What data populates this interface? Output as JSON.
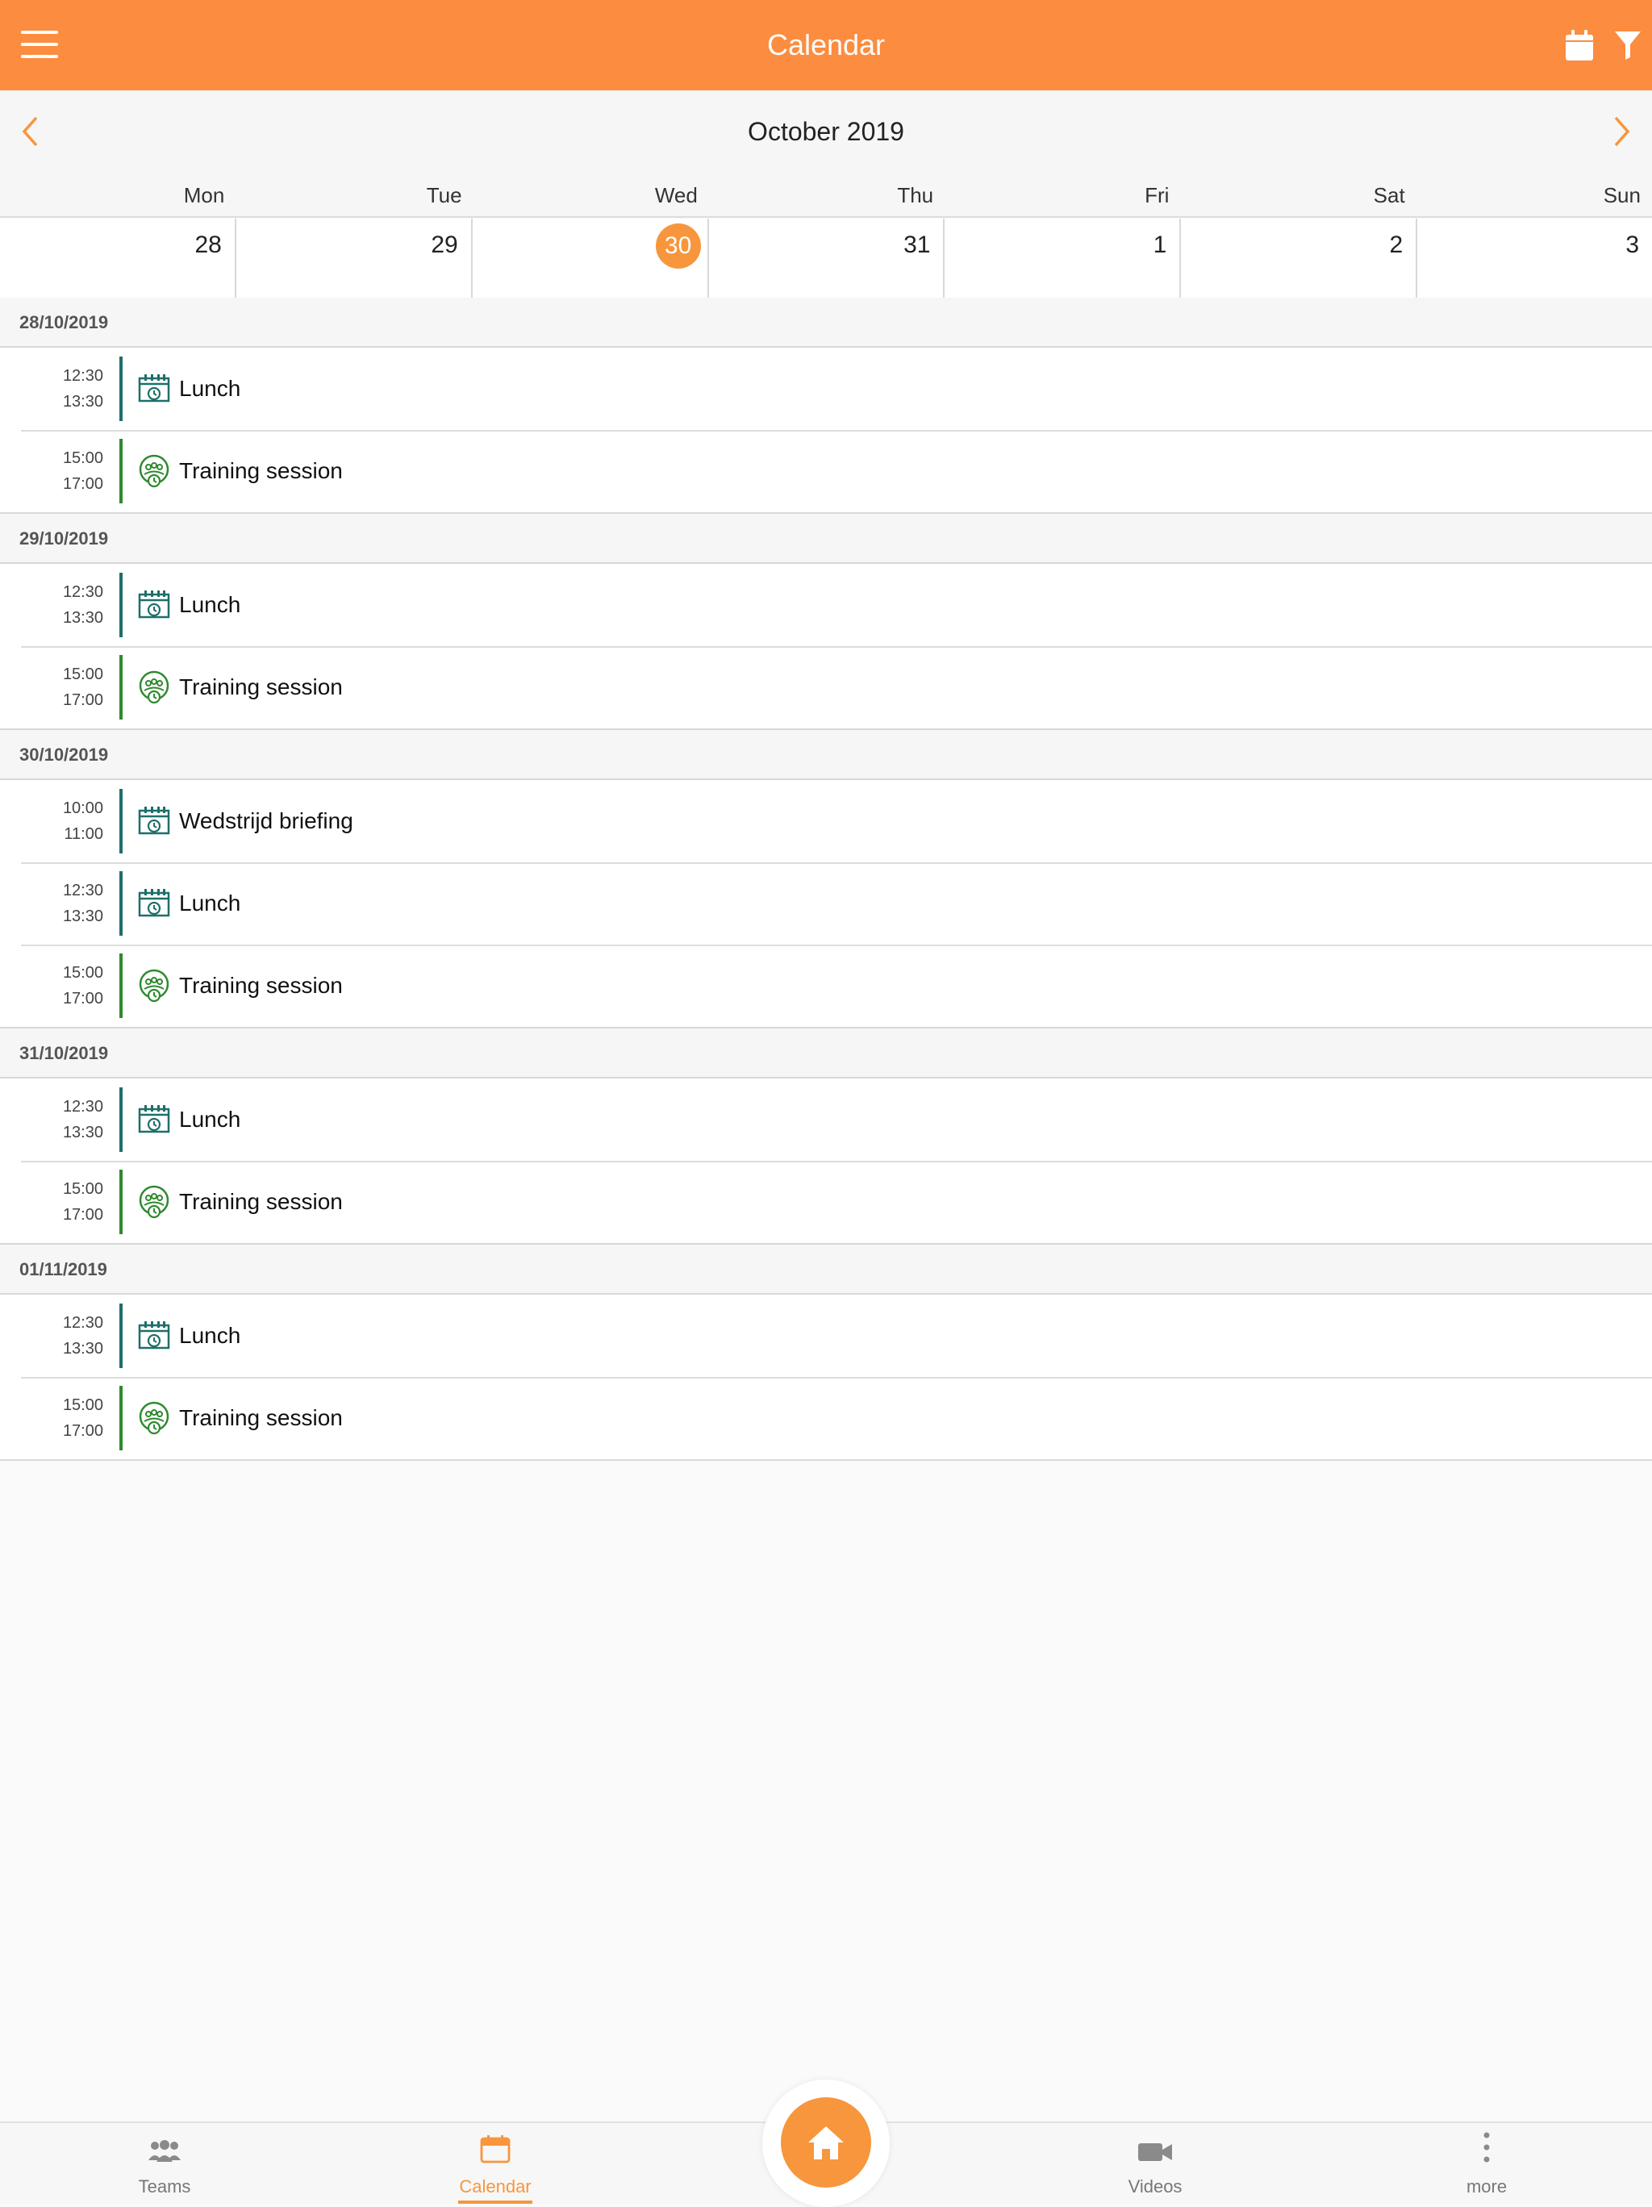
{
  "header": {
    "title": "Calendar",
    "icons": [
      "menu-icon",
      "calendar-icon",
      "filter-icon"
    ]
  },
  "month_nav": {
    "month": "October 2019"
  },
  "week": {
    "days": [
      "Mon",
      "Tue",
      "Wed",
      "Thu",
      "Fri",
      "Sat",
      "Sun"
    ],
    "dates": [
      "28",
      "29",
      "30",
      "31",
      "1",
      "2",
      "3"
    ],
    "today_index": 2,
    "accent": "#f7963c"
  },
  "agenda": [
    {
      "date": "28/10/2019",
      "events": [
        {
          "start": "12:30",
          "end": "13:30",
          "title": "Lunch",
          "type": "meeting"
        },
        {
          "start": "15:00",
          "end": "17:00",
          "title": "Training session",
          "type": "training"
        }
      ]
    },
    {
      "date": "29/10/2019",
      "events": [
        {
          "start": "12:30",
          "end": "13:30",
          "title": "Lunch",
          "type": "meeting"
        },
        {
          "start": "15:00",
          "end": "17:00",
          "title": "Training session",
          "type": "training"
        }
      ]
    },
    {
      "date": "30/10/2019",
      "events": [
        {
          "start": "10:00",
          "end": "11:00",
          "title": "Wedstrijd briefing",
          "type": "meeting"
        },
        {
          "start": "12:30",
          "end": "13:30",
          "title": "Lunch",
          "type": "meeting"
        },
        {
          "start": "15:00",
          "end": "17:00",
          "title": "Training session",
          "type": "training"
        }
      ]
    },
    {
      "date": "31/10/2019",
      "events": [
        {
          "start": "12:30",
          "end": "13:30",
          "title": "Lunch",
          "type": "meeting"
        },
        {
          "start": "15:00",
          "end": "17:00",
          "title": "Training session",
          "type": "training"
        }
      ]
    },
    {
      "date": "01/11/2019",
      "events": [
        {
          "start": "12:30",
          "end": "13:30",
          "title": "Lunch",
          "type": "meeting"
        },
        {
          "start": "15:00",
          "end": "17:00",
          "title": "Training session",
          "type": "training"
        }
      ]
    }
  ],
  "bottom_nav": {
    "teams": "Teams",
    "calendar": "Calendar",
    "videos": "Videos",
    "more": "more",
    "active": "calendar"
  },
  "colors": {
    "header": "#fc8c3f",
    "accent": "#f7963c",
    "meeting": "#1e6f6a",
    "training": "#2f8a2f"
  }
}
